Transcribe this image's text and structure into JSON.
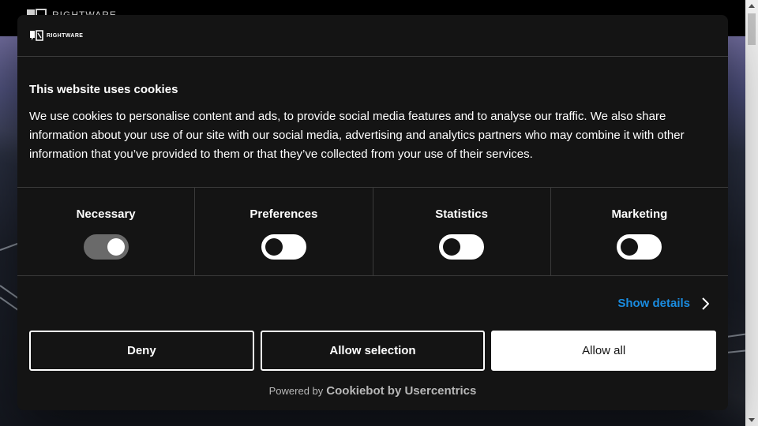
{
  "site": {
    "logo_text": "RIGHTWARE"
  },
  "dialog": {
    "brand_text": "RIGHTWARE",
    "title": "This website uses cookies",
    "text": "We use cookies to personalise content and ads, to provide social media features and to analyse our traffic. We also share information about your use of our site with our social media, advertising and analytics partners who may combine it with other information that you’ve provided to them or that they’ve collected from your use of their services.",
    "categories": [
      {
        "label": "Necessary",
        "enabled": true
      },
      {
        "label": "Preferences",
        "enabled": false
      },
      {
        "label": "Statistics",
        "enabled": false
      },
      {
        "label": "Marketing",
        "enabled": false
      }
    ],
    "show_details_label": "Show details",
    "buttons": {
      "deny": "Deny",
      "allow_selection": "Allow selection",
      "allow_all": "Allow all"
    },
    "powered_by_prefix": "Powered by",
    "powered_by_brand": "Cookiebot by Usercentrics"
  },
  "colors": {
    "dialog_bg": "#141414",
    "link_accent": "#1a8ce0",
    "toggle_on": "#6a6a6a"
  }
}
